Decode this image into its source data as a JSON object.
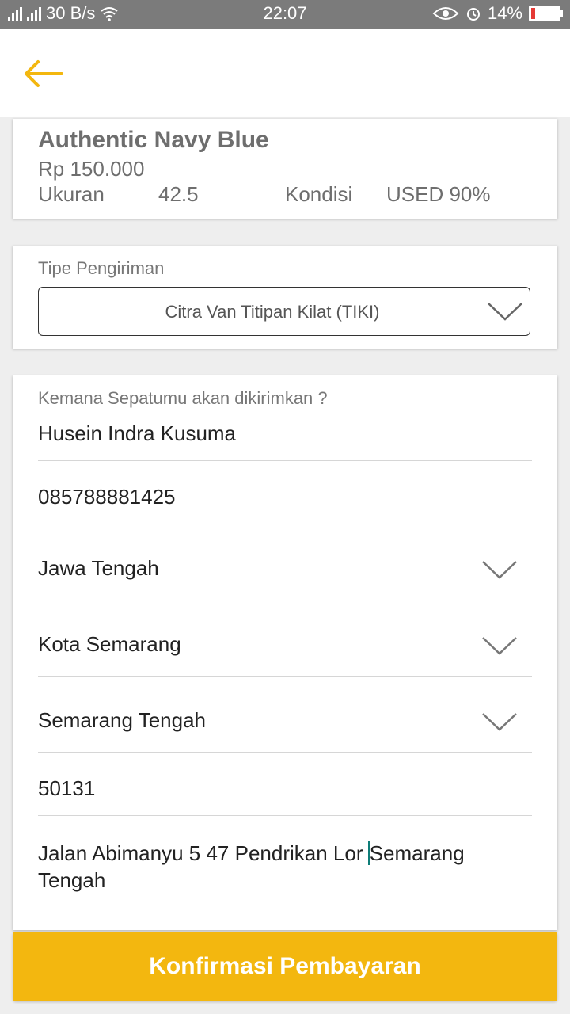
{
  "status_bar": {
    "network_speed": "30 B/s",
    "time": "22:07",
    "battery_percent": "14%",
    "icons": [
      "signal-icon",
      "signal-icon",
      "wifi-icon",
      "eye-icon",
      "alarm-icon",
      "battery-icon"
    ]
  },
  "appbar": {
    "back_icon": "arrow-left-icon",
    "accent_color": "#f3b70f"
  },
  "product": {
    "name": "Authentic Navy Blue",
    "price": "Rp 150.000",
    "size_label": "Ukuran",
    "size_value": "42.5",
    "condition_label": "Kondisi",
    "condition_value": "USED 90%"
  },
  "shipping": {
    "label": "Tipe Pengiriman",
    "selected": "Citra Van Titipan Kilat (TIKI)"
  },
  "address": {
    "label": "Kemana Sepatumu akan dikirimkan ?",
    "name": "Husein Indra Kusuma",
    "phone": "085788881425",
    "province": "Jawa Tengah",
    "city": "Kota Semarang",
    "district": "Semarang Tengah",
    "postal_code": "50131",
    "street_before_cursor": "Jalan Abimanyu 5 47 Pendrikan Lor ",
    "street_after_cursor": "Semarang Tengah"
  },
  "confirm_button": {
    "label": "Konfirmasi Pembayaran",
    "color": "#f3b70f"
  }
}
